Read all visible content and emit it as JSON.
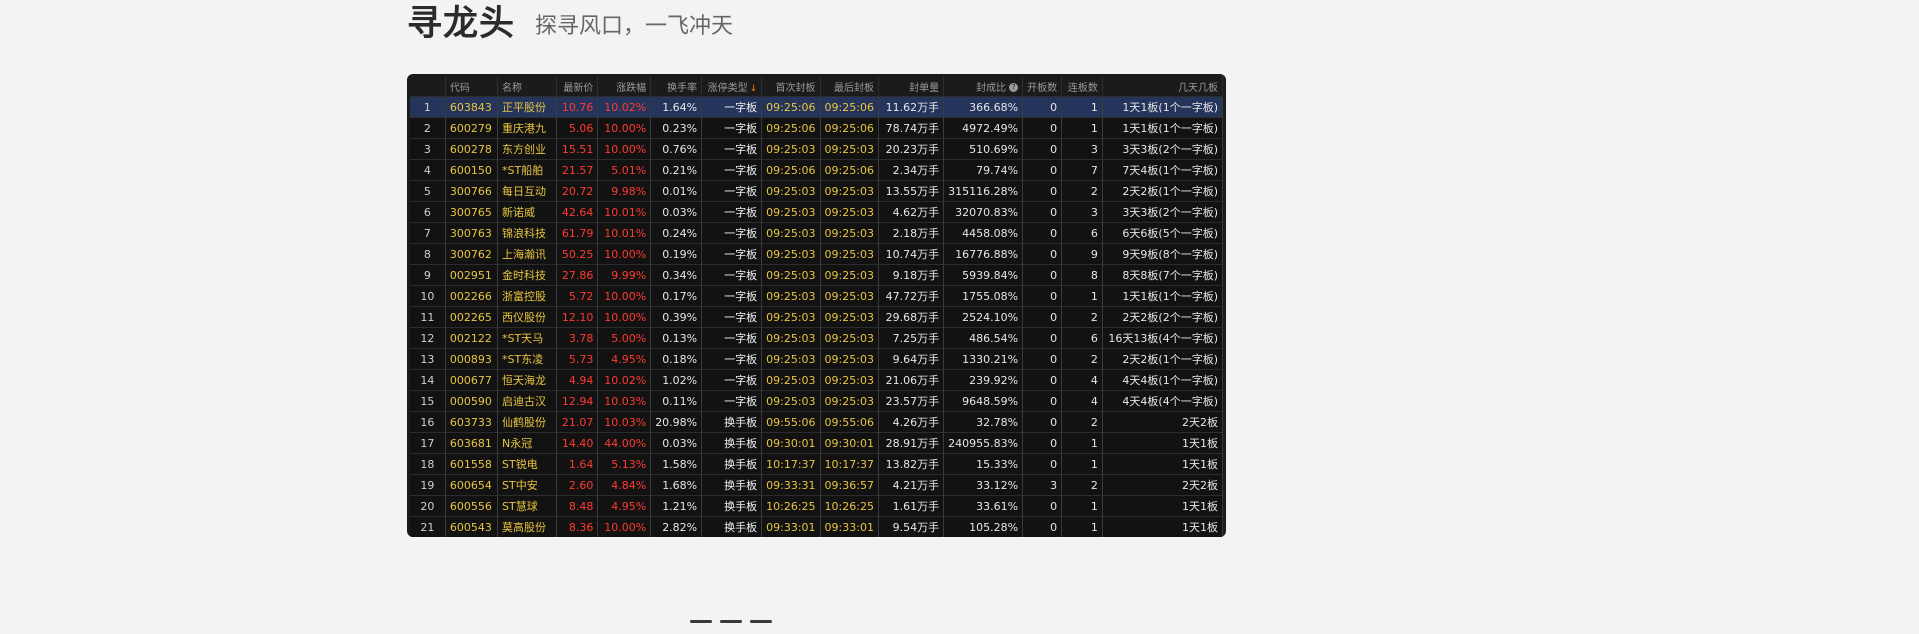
{
  "header": {
    "title": "寻龙头",
    "subtitle": "探寻风口，一飞冲天"
  },
  "table": {
    "columns": [
      "",
      "代码",
      "名称",
      "最新价",
      "涨跌幅",
      "换手率",
      "涨停类型",
      "首次封板",
      "最后封板",
      "封单量",
      "封成比",
      "开板数",
      "连板数",
      "几天几板"
    ],
    "rows": [
      [
        "1",
        "603843",
        "正平股份",
        "10.76",
        "10.02%",
        "1.64%",
        "一字板",
        "09:25:06",
        "09:25:06",
        "11.62万手",
        "366.68%",
        "0",
        "1",
        "1天1板(1个一字板)"
      ],
      [
        "2",
        "600279",
        "重庆港九",
        "5.06",
        "10.00%",
        "0.23%",
        "一字板",
        "09:25:06",
        "09:25:06",
        "78.74万手",
        "4972.49%",
        "0",
        "1",
        "1天1板(1个一字板)"
      ],
      [
        "3",
        "600278",
        "东方创业",
        "15.51",
        "10.00%",
        "0.76%",
        "一字板",
        "09:25:03",
        "09:25:03",
        "20.23万手",
        "510.69%",
        "0",
        "3",
        "3天3板(2个一字板)"
      ],
      [
        "4",
        "600150",
        "*ST船舶",
        "21.57",
        "5.01%",
        "0.21%",
        "一字板",
        "09:25:06",
        "09:25:06",
        "2.34万手",
        "79.74%",
        "0",
        "7",
        "7天4板(1个一字板)"
      ],
      [
        "5",
        "300766",
        "每日互动",
        "20.72",
        "9.98%",
        "0.01%",
        "一字板",
        "09:25:03",
        "09:25:03",
        "13.55万手",
        "315116.28%",
        "0",
        "2",
        "2天2板(1个一字板)"
      ],
      [
        "6",
        "300765",
        "新诺威",
        "42.64",
        "10.01%",
        "0.03%",
        "一字板",
        "09:25:03",
        "09:25:03",
        "4.62万手",
        "32070.83%",
        "0",
        "3",
        "3天3板(2个一字板)"
      ],
      [
        "7",
        "300763",
        "锦浪科技",
        "61.79",
        "10.01%",
        "0.24%",
        "一字板",
        "09:25:03",
        "09:25:03",
        "2.18万手",
        "4458.08%",
        "0",
        "6",
        "6天6板(5个一字板)"
      ],
      [
        "8",
        "300762",
        "上海瀚讯",
        "50.25",
        "10.00%",
        "0.19%",
        "一字板",
        "09:25:03",
        "09:25:03",
        "10.74万手",
        "16776.88%",
        "0",
        "9",
        "9天9板(8个一字板)"
      ],
      [
        "9",
        "002951",
        "金时科技",
        "27.86",
        "9.99%",
        "0.34%",
        "一字板",
        "09:25:03",
        "09:25:03",
        "9.18万手",
        "5939.84%",
        "0",
        "8",
        "8天8板(7个一字板)"
      ],
      [
        "10",
        "002266",
        "浙富控股",
        "5.72",
        "10.00%",
        "0.17%",
        "一字板",
        "09:25:03",
        "09:25:03",
        "47.72万手",
        "1755.08%",
        "0",
        "1",
        "1天1板(1个一字板)"
      ],
      [
        "11",
        "002265",
        "西仪股份",
        "12.10",
        "10.00%",
        "0.39%",
        "一字板",
        "09:25:03",
        "09:25:03",
        "29.68万手",
        "2524.10%",
        "0",
        "2",
        "2天2板(2个一字板)"
      ],
      [
        "12",
        "002122",
        "*ST天马",
        "3.78",
        "5.00%",
        "0.13%",
        "一字板",
        "09:25:03",
        "09:25:03",
        "7.25万手",
        "486.54%",
        "0",
        "6",
        "16天13板(4个一字板)"
      ],
      [
        "13",
        "000893",
        "*ST东凌",
        "5.73",
        "4.95%",
        "0.18%",
        "一字板",
        "09:25:03",
        "09:25:03",
        "9.64万手",
        "1330.21%",
        "0",
        "2",
        "2天2板(1个一字板)"
      ],
      [
        "14",
        "000677",
        "恒天海龙",
        "4.94",
        "10.02%",
        "1.02%",
        "一字板",
        "09:25:03",
        "09:25:03",
        "21.06万手",
        "239.92%",
        "0",
        "4",
        "4天4板(1个一字板)"
      ],
      [
        "15",
        "000590",
        "启迪古汉",
        "12.94",
        "10.03%",
        "0.11%",
        "一字板",
        "09:25:03",
        "09:25:03",
        "23.57万手",
        "9648.59%",
        "0",
        "4",
        "4天4板(4个一字板)"
      ],
      [
        "16",
        "603733",
        "仙鹤股份",
        "21.07",
        "10.03%",
        "20.98%",
        "换手板",
        "09:55:06",
        "09:55:06",
        "4.26万手",
        "32.78%",
        "0",
        "2",
        "2天2板"
      ],
      [
        "17",
        "603681",
        "N永冠",
        "14.40",
        "44.00%",
        "0.03%",
        "换手板",
        "09:30:01",
        "09:30:01",
        "28.91万手",
        "240955.83%",
        "0",
        "1",
        "1天1板"
      ],
      [
        "18",
        "601558",
        "ST锐电",
        "1.64",
        "5.13%",
        "1.58%",
        "换手板",
        "10:17:37",
        "10:17:37",
        "13.82万手",
        "15.33%",
        "0",
        "1",
        "1天1板"
      ],
      [
        "19",
        "600654",
        "ST中安",
        "2.60",
        "4.84%",
        "1.68%",
        "换手板",
        "09:33:31",
        "09:36:57",
        "4.21万手",
        "33.12%",
        "3",
        "2",
        "2天2板"
      ],
      [
        "20",
        "600556",
        "ST慧球",
        "8.48",
        "4.95%",
        "1.21%",
        "换手板",
        "10:26:25",
        "10:26:25",
        "1.61万手",
        "33.61%",
        "0",
        "1",
        "1天1板"
      ],
      [
        "21",
        "600543",
        "莫高股份",
        "8.36",
        "10.00%",
        "2.82%",
        "换手板",
        "09:33:01",
        "09:33:01",
        "9.54万手",
        "105.28%",
        "0",
        "1",
        "1天1板"
      ]
    ]
  },
  "icons": {
    "sort": "sort-desc-icon",
    "help": "question-icon"
  },
  "colors": {
    "accent_yellow": "#e8c440",
    "up_red": "#ff3a30",
    "selected_row": "#24345a",
    "panel_bg": "#1b1b1b"
  }
}
